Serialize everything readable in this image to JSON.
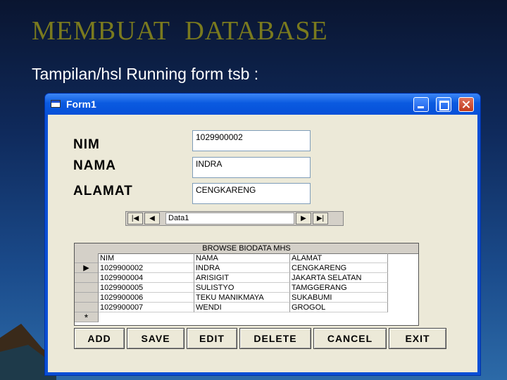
{
  "slide": {
    "title": "MEMBUAT  DATABASE",
    "subtitle": "Tampilan/hsl Running form tsb :"
  },
  "window": {
    "title": "Form1",
    "icons": [
      "app-form-icon",
      "minimize-icon",
      "maximize-icon",
      "close-icon"
    ]
  },
  "form": {
    "nim_label": "NIM",
    "nama_label": "NAMA",
    "alamat_label": "ALAMAT",
    "nim_value": "1029900002",
    "nama_value": "INDRA",
    "alamat_value": "CENGKARENG"
  },
  "data_control": {
    "caption": "Data1",
    "first": "|◀",
    "prev": "◀",
    "next": "▶",
    "last": "▶|"
  },
  "grid": {
    "caption": "BROWSE BIODATA MHS",
    "columns": [
      "NIM",
      "NAMA",
      "ALAMAT"
    ],
    "current_marker": "▶",
    "new_marker": "*",
    "rows": [
      [
        "1029900002",
        "INDRA",
        "CENGKARENG"
      ],
      [
        "1029900004",
        "ARISIGIT",
        "JAKARTA SELATAN"
      ],
      [
        "1029900005",
        "SULISTYO",
        "TAMGGERANG"
      ],
      [
        "1029900006",
        "TEKU MANIKMAYA",
        "SUKABUMI"
      ],
      [
        "1029900007",
        "WENDI",
        "GROGOL"
      ]
    ]
  },
  "buttons": {
    "add": "ADD",
    "save": "SAVE",
    "edit": "EDIT",
    "delete": "DELETE",
    "cancel": "CANCEL",
    "exit": "EXIT"
  }
}
